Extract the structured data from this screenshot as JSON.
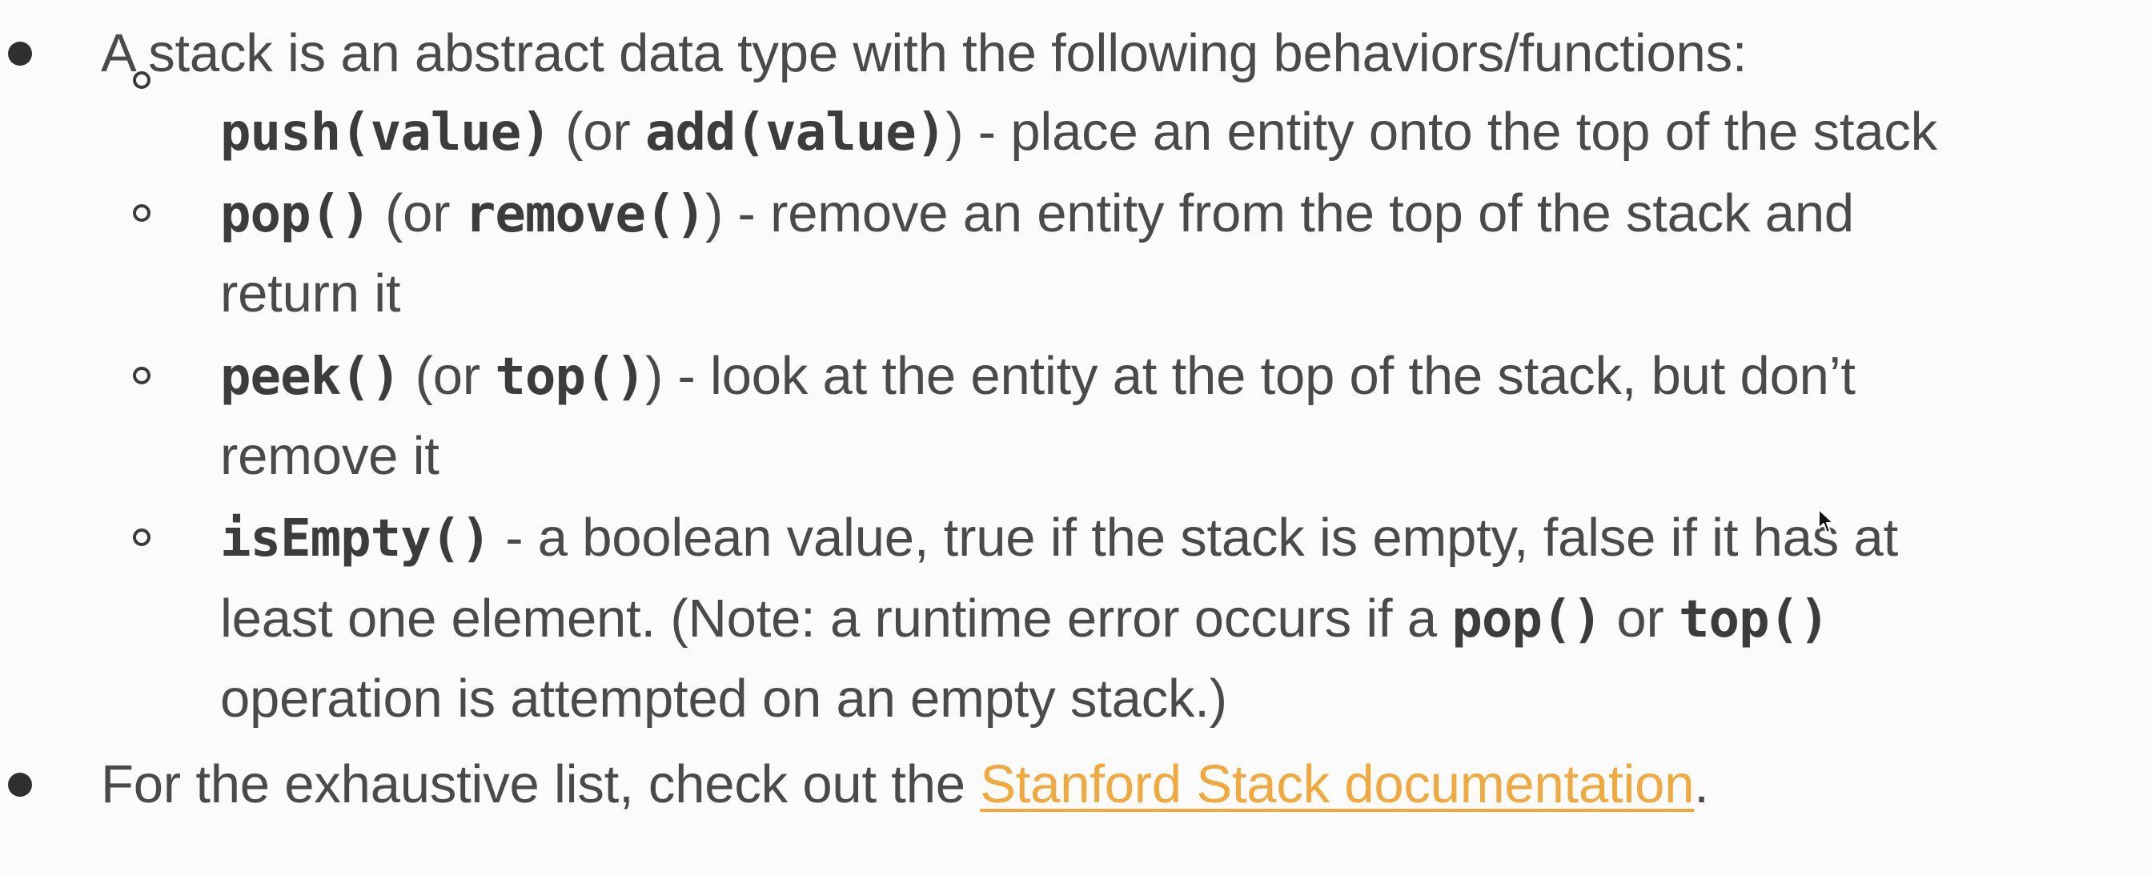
{
  "bullets": [
    {
      "text": "A stack is an abstract data type with the following behaviors/functions:"
    },
    {
      "prefix": "For the exhaustive list, check out the ",
      "link_text": "Stanford Stack documentation",
      "suffix": "."
    }
  ],
  "subitems": [
    {
      "code1": "push(value)",
      "t1": " (or ",
      "code2": "add(value)",
      "t2": ") - place an entity onto the top of the stack"
    },
    {
      "code1": "pop()",
      "t1": " (or ",
      "code2": "remove()",
      "t2": ") - remove an entity from the top of the stack and",
      "line2": "return it"
    },
    {
      "code1": "peek()",
      "t1": " (or ",
      "code2": "top()",
      "t2": ") - look at the entity at the top of the stack, but don’t",
      "line2": "remove it"
    },
    {
      "code1": "isEmpty()",
      "t1": " - a boolean value, true if the stack is empty, false if it has at",
      "line2_pre": "least one element. (Note: a runtime error occurs if a ",
      "line2_code1": "pop()",
      "line2_mid": " or ",
      "line2_code2": "top()",
      "line3": "operation is attempted on an empty stack.)"
    }
  ],
  "colors": {
    "text": "#4a4a4a",
    "link": "#f2a93b",
    "background": "#fbfbfb"
  },
  "icons": {
    "cursor": "mouse-pointer-icon"
  }
}
